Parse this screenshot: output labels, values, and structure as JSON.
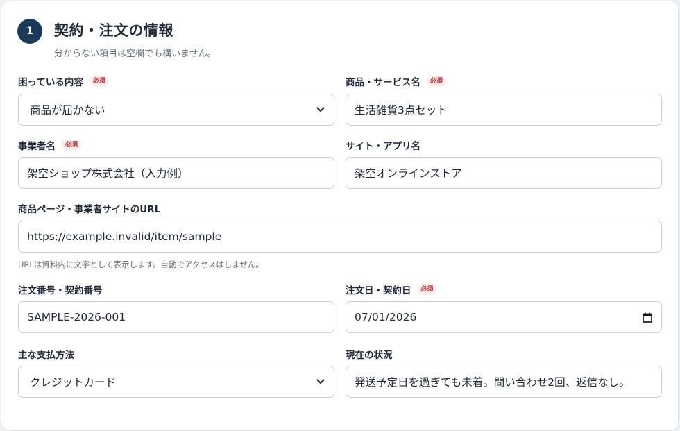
{
  "section": {
    "step_number": "1",
    "title": "契約・注文の情報",
    "subtitle": "分からない項目は空欄でも構いません。"
  },
  "required_label": "必須",
  "fields": {
    "issue": {
      "label": "困っている内容",
      "value": "商品が届かない",
      "required": true,
      "type": "select"
    },
    "product": {
      "label": "商品・サービス名",
      "value": "生活雑貨3点セット",
      "required": true,
      "type": "text"
    },
    "business": {
      "label": "事業者名",
      "value": "架空ショップ株式会社（入力例）",
      "required": true,
      "type": "text"
    },
    "site": {
      "label": "サイト・アプリ名",
      "value": "架空オンラインストア",
      "required": false,
      "type": "text"
    },
    "url": {
      "label": "商品ページ・事業者サイトのURL",
      "value": "https://example.invalid/item/sample",
      "required": false,
      "type": "text",
      "hint": "URLは資料内に文字として表示します。自動でアクセスはしません。"
    },
    "order_number": {
      "label": "注文番号・契約番号",
      "value": "SAMPLE-2026-001",
      "required": false,
      "type": "text"
    },
    "order_date": {
      "label": "注文日・契約日",
      "value": "07/01/2026",
      "required": true,
      "type": "date"
    },
    "payment": {
      "label": "主な支払方法",
      "value": "クレジットカード",
      "required": false,
      "type": "select"
    },
    "status": {
      "label": "現在の状況",
      "value": "発送予定日を過ぎても未着。問い合わせ2回、返信なし。",
      "required": false,
      "type": "text"
    }
  },
  "colors": {
    "badge_bg": "#1b3a57",
    "required_bg": "#fdecec",
    "required_text": "#c62828",
    "border": "#c9d0d8"
  },
  "icons": {
    "select": "chevron-down-icon",
    "date": "calendar-icon"
  }
}
